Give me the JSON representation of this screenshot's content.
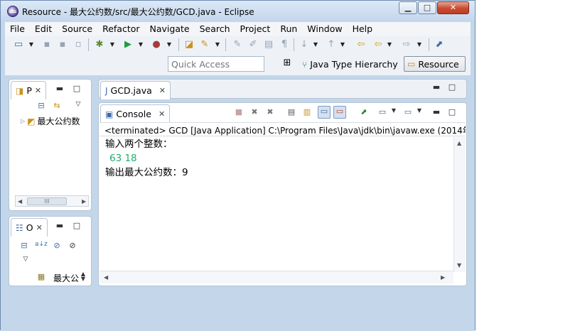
{
  "window": {
    "title": "Resource - 最大公约数/src/最大公约数/GCD.java - Eclipse",
    "minimize": "▁",
    "maximize": "□",
    "close": "✕"
  },
  "menu": [
    "File",
    "Edit",
    "Source",
    "Refactor",
    "Navigate",
    "Search",
    "Project",
    "Run",
    "Window",
    "Help"
  ],
  "toolbar": {
    "quick_access_placeholder": "Quick Access",
    "perspectives": [
      "Java Type Hierarchy",
      "Resource"
    ]
  },
  "package_explorer": {
    "tab_label": "P",
    "tree_item": "最大公约数",
    "hscroll_thumb": "III"
  },
  "outline": {
    "tab_label": "O",
    "item": "最大公"
  },
  "editor": {
    "tab_label": "GCD.java"
  },
  "console": {
    "tab_label": "Console",
    "status": "<terminated> GCD [Java Application] C:\\Program Files\\Java\\jdk\\bin\\javaw.exe (2014年1",
    "lines": [
      {
        "text": "输入两个整数：",
        "kind": "output"
      },
      {
        "text": "63 18",
        "kind": "input"
      },
      {
        "text": "输出最大公约数：9",
        "kind": "output"
      }
    ]
  },
  "colors": {
    "frame": "#c3d6ea",
    "input_text": "#1fae6e",
    "close_button": "#c74b32"
  }
}
